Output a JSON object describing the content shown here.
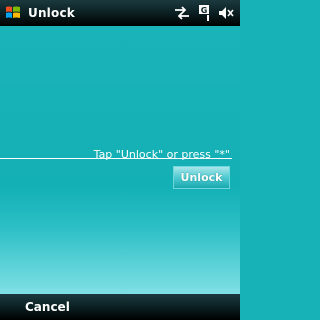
{
  "window": {
    "title": "Unlock"
  },
  "icons": {
    "start": "windows-start-icon",
    "connectivity": "connectivity-arrows-icon",
    "signal": "gprs-signal-icon",
    "volume": "speaker-muted-icon"
  },
  "signal": {
    "label": "G"
  },
  "lock_screen": {
    "instruction": "Tap \"Unlock\" or press \"*\"",
    "unlock_label": "Unlock"
  },
  "softkeys": {
    "left": "Cancel"
  },
  "colors": {
    "background": "#17b2b8",
    "bar": "#0d2326",
    "button": "#4fcad1",
    "text": "#ffffff"
  }
}
